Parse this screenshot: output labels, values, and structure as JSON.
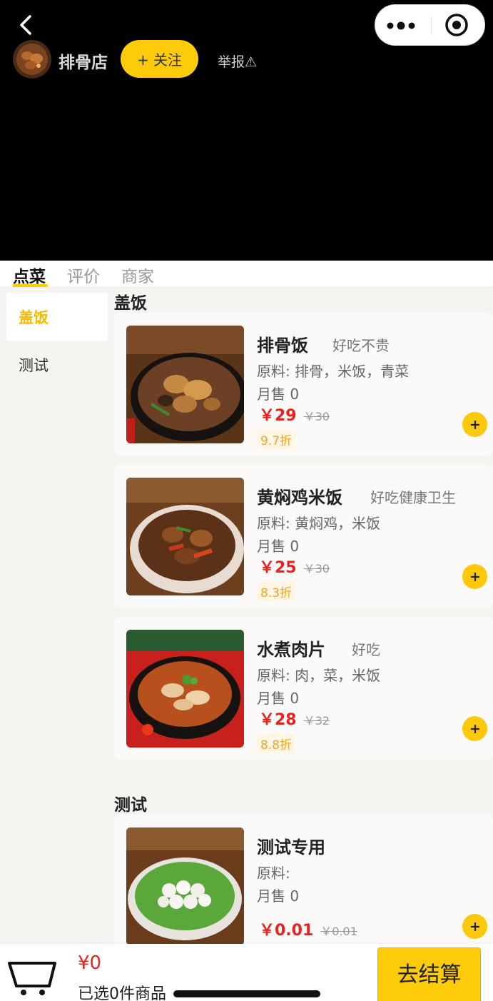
{
  "header": {
    "shop_name": "排骨店",
    "follow_label": "+ 关注",
    "report_label": "举报⚠",
    "back_icon": "chevron-left-icon",
    "capsule_icons": [
      "more-dots-icon",
      "target-icon"
    ]
  },
  "tabs": [
    {
      "label": "点菜",
      "active": true
    },
    {
      "label": "评价",
      "active": false
    },
    {
      "label": "商家",
      "active": false
    }
  ],
  "categories": [
    {
      "label": "盖饭",
      "active": true
    },
    {
      "label": "测试",
      "active": false
    }
  ],
  "sections": [
    {
      "title": "盖饭",
      "items": [
        {
          "name": "排骨饭",
          "slogan": "好吃不贵",
          "ingredients": "原料: 排骨，米饭，青菜",
          "sales": "月售 0",
          "price": "￥29",
          "original_price": "￥30",
          "discount": "9.7折"
        },
        {
          "name": "黄焖鸡米饭",
          "slogan": "好吃健康卫生",
          "ingredients": "原料: 黄焖鸡，米饭",
          "sales": "月售 0",
          "price": "￥25",
          "original_price": "￥30",
          "discount": "8.3折"
        },
        {
          "name": "水煮肉片",
          "slogan": "好吃",
          "ingredients": "原料: 肉，菜，米饭",
          "sales": "月售 0",
          "price": "￥28",
          "original_price": "￥32",
          "discount": "8.8折"
        }
      ]
    },
    {
      "title": "测试",
      "items": [
        {
          "name": "测试专用",
          "slogan": "",
          "ingredients": "原料:",
          "sales": "月售 0",
          "price": "￥0.01",
          "original_price": "￥0.01",
          "discount": ""
        }
      ]
    }
  ],
  "cart": {
    "total": "¥0",
    "count_text": "已选0件商品",
    "checkout_label": "去结算"
  },
  "colors": {
    "accent": "#fecb0a",
    "price": "#e8231f",
    "discount_text": "#f3a51d",
    "header_bg": "#000000"
  }
}
